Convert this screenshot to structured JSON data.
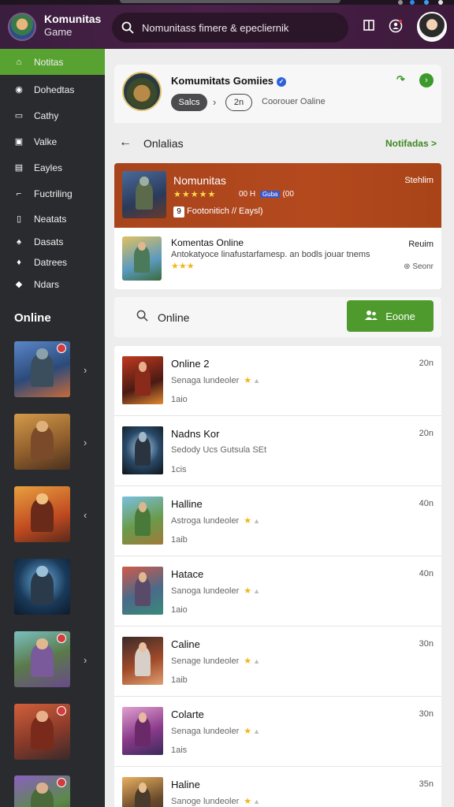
{
  "app": {
    "title": "Komunitas",
    "subtitle": "Game",
    "search_text": "Nomunitass fimere & epecliernik"
  },
  "colors": {
    "accent_green": "#58a232",
    "featured_orange": "#b4491e",
    "topbar": "#4a2048"
  },
  "sidebar": {
    "items": [
      {
        "label": "Notitas",
        "icon": "home-icon",
        "glyph": "⌂"
      },
      {
        "label": "Dohedtas",
        "icon": "compass-icon",
        "glyph": "◉"
      },
      {
        "label": "Cathy",
        "icon": "chat-icon",
        "glyph": "▭"
      },
      {
        "label": "Valke",
        "icon": "image-icon",
        "glyph": "▣"
      },
      {
        "label": "Eayles",
        "icon": "gallery-icon",
        "glyph": "▤"
      },
      {
        "label": "Fuctriling",
        "icon": "trophy-icon",
        "glyph": "⌐"
      },
      {
        "label": "Neatats",
        "icon": "phone-icon",
        "glyph": "▯"
      },
      {
        "label": "Dasats",
        "icon": "bell-icon",
        "glyph": "♠"
      },
      {
        "label": "Datrees",
        "icon": "bird-icon",
        "glyph": "♦"
      },
      {
        "label": "Ndars",
        "icon": "eye-icon",
        "glyph": "◆"
      }
    ],
    "section_title": "Online"
  },
  "header": {
    "title": "Komumitats Gomiies",
    "pill_dark": "Salcs",
    "pill_outline": "2n",
    "status": "Coorouer Oaline"
  },
  "back_row": {
    "title": "Onlalias",
    "link": "Notifadas >"
  },
  "featured": {
    "title": "Nomunitas",
    "stars": "★★★★★",
    "meta_prefix": "00 H",
    "chip": "Guba",
    "meta_suffix": "(00",
    "line_number": "9",
    "line_text": "Footonitich // Eaysl)",
    "status": "Stehlim"
  },
  "secondary": {
    "title": "Komentas Online",
    "desc": "Antokatyoce linafustarfamesp. an bodls jouar tnems",
    "stars": "★★★",
    "status": "Reuim",
    "status2": "Seonr"
  },
  "search": {
    "label": "Online",
    "button": "Eoone"
  },
  "list": [
    {
      "title": "Online 2",
      "sub": "Senaga lundeoler",
      "meta": "1aio",
      "time": "20n"
    },
    {
      "title": "Nadns Kor",
      "sub": "Sedody Ucs Gutsula SEt",
      "meta": "1cis",
      "time": "20n"
    },
    {
      "title": "Halline",
      "sub": "Astroga lundeoler",
      "meta": "1aib",
      "time": "40n"
    },
    {
      "title": "Hatace",
      "sub": "Sanoga lundeoler",
      "meta": "1aio",
      "time": "40n"
    },
    {
      "title": "Caline",
      "sub": "Senage lundeoler",
      "meta": "1aib",
      "time": "30n"
    },
    {
      "title": "Colarte",
      "sub": "Senaga lundeoler",
      "meta": "1ais",
      "time": "30n"
    },
    {
      "title": "Haline",
      "sub": "Sanoge lundeoler",
      "meta": "",
      "time": "35n"
    }
  ]
}
